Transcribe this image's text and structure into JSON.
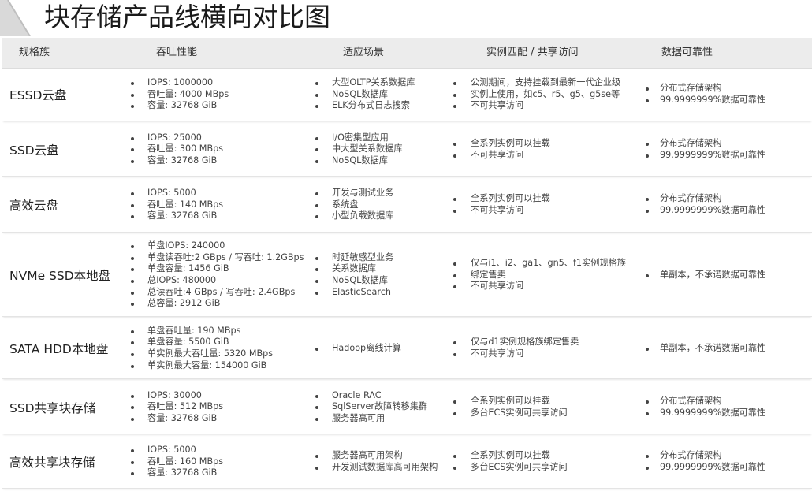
{
  "page": {
    "title": "块存储产品线横向对比图"
  },
  "table": {
    "headers": [
      "规格族",
      "吞吐性能",
      "适应场景",
      "实例匹配 / 共享访问",
      "数据可靠性"
    ],
    "rows": [
      {
        "name": "ESSD云盘",
        "performance": [
          "IOPS: 1000000",
          "吞吐量: 4000 MBps",
          "容量: 32768 GiB"
        ],
        "scenarios": [
          "大型OLTP关系数据库",
          "NoSQL数据库",
          "ELK分布式日志搜索"
        ],
        "instance": [
          "公测期间，支持挂载到最新一代企业级",
          "实例上使用，如c5、r5、g5、g5se等",
          "不可共享访问"
        ],
        "reliability": [
          "分布式存储架构",
          "99.9999999%数据可靠性"
        ]
      },
      {
        "name": "SSD云盘",
        "performance": [
          "IOPS: 25000",
          "吞吐量: 300 MBps",
          "容量: 32768 GiB"
        ],
        "scenarios": [
          "I/O密集型应用",
          "中大型关系数据库",
          "NoSQL数据库"
        ],
        "instance": [
          "全系列实例可以挂载",
          "不可共享访问"
        ],
        "reliability": [
          "分布式存储架构",
          "99.9999999%数据可靠性"
        ]
      },
      {
        "name": "高效云盘",
        "performance": [
          "IOPS: 5000",
          "吞吐量: 140 MBps",
          "容量: 32768 GiB"
        ],
        "scenarios": [
          "开发与测试业务",
          "系统盘",
          "小型负载数据库"
        ],
        "instance": [
          "全系列实例可以挂载",
          "不可共享访问"
        ],
        "reliability": [
          "分布式存储架构",
          "99.9999999%数据可靠性"
        ]
      },
      {
        "name": "NVMe SSD本地盘",
        "performance": [
          "单盘IOPS: 240000",
          "单盘读吞吐:2 GBps / 写吞吐: 1.2GBps",
          "单盘容量: 1456 GiB",
          "总IOPS: 480000",
          "总读吞吐:4 GBps / 写吞吐: 2.4GBps",
          "总容量: 2912 GiB"
        ],
        "scenarios": [
          "时延敏感型业务",
          "关系数据库",
          "NoSQL数据库",
          "ElasticSearch"
        ],
        "instance": [
          "仅与i1、i2、ga1、gn5、f1实例规格族",
          "绑定售卖",
          "不可共享访问"
        ],
        "reliability": [
          "单副本，不承诺数据可靠性"
        ]
      },
      {
        "name": "SATA HDD本地盘",
        "performance": [
          "单盘吞吐量: 190 MBps",
          "单盘容量: 5500 GiB",
          "单实例最大吞吐量: 5320 MBps",
          "单实例最大容量: 154000 GiB"
        ],
        "scenarios": [
          "Hadoop离线计算"
        ],
        "instance": [
          "仅与d1实例规格族绑定售卖",
          "不可共享访问"
        ],
        "reliability": [
          "单副本，不承诺数据可靠性"
        ]
      },
      {
        "name": "SSD共享块存储",
        "performance": [
          "IOPS: 30000",
          "吞吐量: 512 MBps",
          "容量: 32768 GiB"
        ],
        "scenarios": [
          "Oracle RAC",
          "SqlServer故障转移集群",
          "服务器高可用"
        ],
        "instance": [
          "全系列实例可以挂载",
          "多台ECS实例可共享访问"
        ],
        "reliability": [
          "分布式存储架构",
          "99.9999999%数据可靠性"
        ]
      },
      {
        "name": "高效共享块存储",
        "performance": [
          "IOPS: 5000",
          "吞吐量: 160 MBps",
          "容量: 32768 GiB"
        ],
        "scenarios": [
          "服务器高可用架构",
          "开发测试数据库高可用架构"
        ],
        "instance": [
          "全系列实例可以挂载",
          "多台ECS实例可共享访问"
        ],
        "reliability": [
          "分布式存储架构",
          "99.9999999%数据可靠性"
        ]
      }
    ]
  }
}
